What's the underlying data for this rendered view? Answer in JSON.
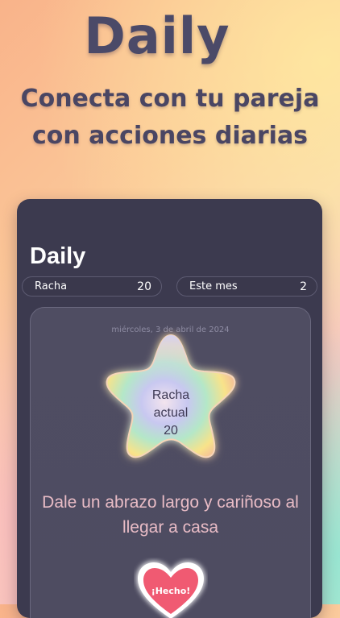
{
  "hero": {
    "title": "Daily",
    "subtitle": "Conecta con tu pareja con acciones diarias"
  },
  "app": {
    "title": "Daily",
    "stats": [
      {
        "label": "Racha",
        "value": "20"
      },
      {
        "label": "Este mes",
        "value": "2"
      }
    ],
    "card": {
      "date": "miércoles, 3 de abril de 2024",
      "streak_lines": [
        "Racha",
        "actual",
        "20"
      ],
      "task": "Dale un abrazo largo y cariñoso al llegar a casa",
      "done_label": "¡Hecho!"
    }
  },
  "icons": {
    "star": "star-icon",
    "heart": "heart-icon"
  },
  "colors": {
    "phone_bg": "#3c3a4f",
    "task_text": "#e9bcc6",
    "heart": "#f05a72"
  }
}
